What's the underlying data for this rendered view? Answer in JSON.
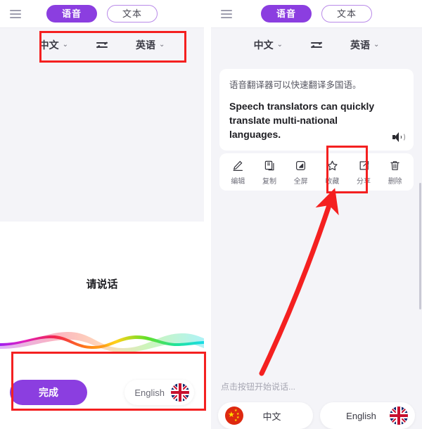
{
  "app": {
    "menu_icon": "hamburger-menu-icon",
    "mode_tabs": [
      {
        "label": "语音",
        "state": "active"
      },
      {
        "label": "文本",
        "state": "idle"
      }
    ]
  },
  "language_bar": {
    "source": "中文",
    "target": "英语",
    "chevron": "⌄",
    "swap_icon": "swap-arrows-icon"
  },
  "translation_card": {
    "source_text": "语音翻译器可以快速翻译多国语。",
    "target_text": "Speech translators can quickly translate multi-national languages.",
    "speaker_icon": "speaker-icon"
  },
  "actions": [
    {
      "label": "编辑",
      "icon": "pencil-edit-icon"
    },
    {
      "label": "复制",
      "icon": "copy-icon"
    },
    {
      "label": "全屏",
      "icon": "fullscreen-icon"
    },
    {
      "label": "收藏",
      "icon": "star-favorite-icon"
    },
    {
      "label": "分享",
      "icon": "share-icon"
    },
    {
      "label": "删除",
      "icon": "trash-delete-icon"
    }
  ],
  "right_panel": {
    "hint": "点击按钮开始说话...",
    "lang_buttons": [
      {
        "label": "中文",
        "flag": "flag-china-icon"
      },
      {
        "label": "English",
        "flag": "flag-uk-icon"
      }
    ]
  },
  "speech_sheet": {
    "prompt": "请说话",
    "done_label": "完成",
    "chip_label": "English",
    "chip_flag": "flag-uk-icon",
    "waveform_icon": "audio-waveform-icon"
  },
  "colors": {
    "accent_purple": "#8b3ee0",
    "annotation_red": "#f42020",
    "page_bg": "#f4f4f8",
    "card_bg": "#ffffff"
  },
  "annotations": {
    "box_language_bar": "highlight-language-selector",
    "box_share_action": "highlight-share-button",
    "box_done_row": "highlight-done-button-row",
    "arrow": "pointer-arrow-to-share"
  }
}
